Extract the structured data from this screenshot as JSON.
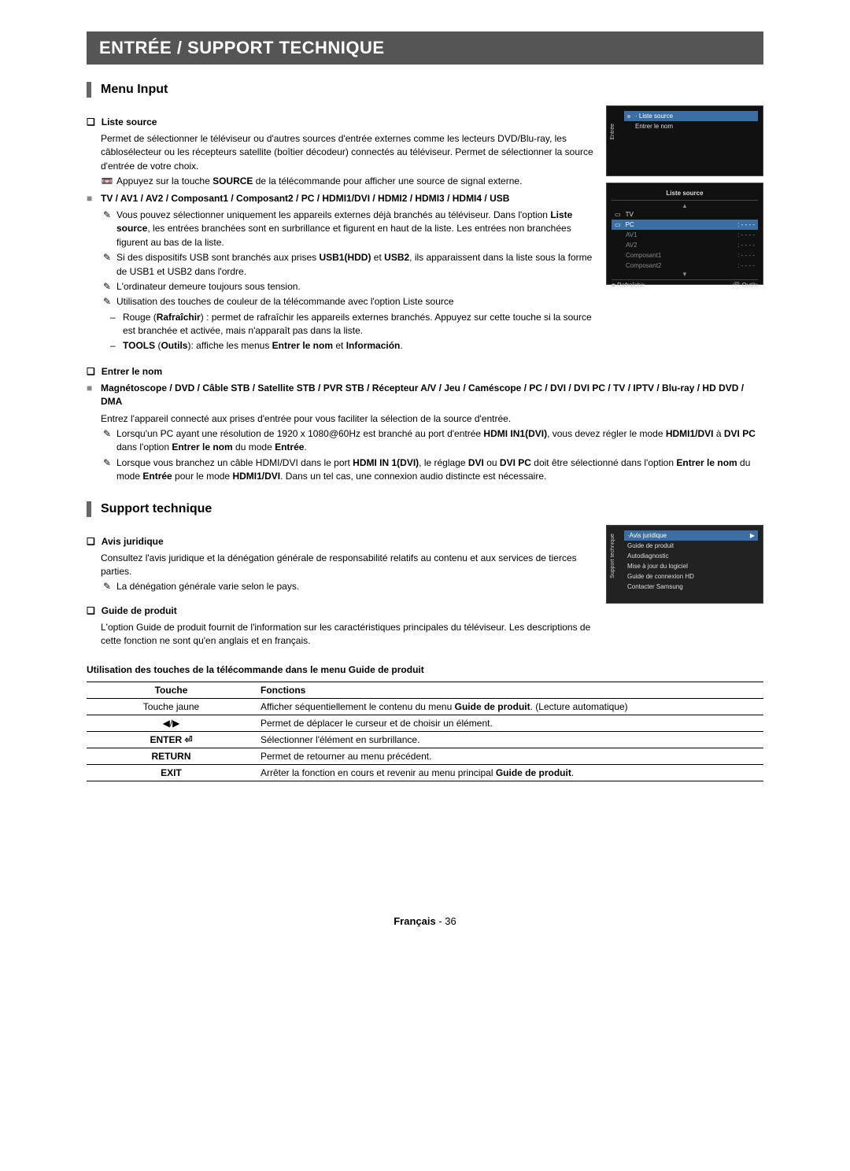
{
  "banner": "ENTRÉE / SUPPORT TECHNIQUE",
  "section1": {
    "title": "Menu Input",
    "liste_source": {
      "heading": "Liste source",
      "p1": "Permet de sélectionner le téléviseur ou d'autres sources d'entrée externes comme les lecteurs DVD/Blu-ray, les câblosélecteur ou les récepteurs satellite (boîtier décodeur) connectés au téléviseur. Permet de sélectionner la source d'entrée de votre choix.",
      "note_icon": "📼",
      "note1_pre": "Appuyez sur la touche ",
      "note1_b": "SOURCE",
      "note1_post": " de la télécommande pour afficher une source de signal externe.",
      "square": "■",
      "src_list_b": "TV / AV1 / AV2 / Composant1 / Composant2 / PC / HDMI1/DVI / HDMI2 / HDMI3 / HDMI4 / USB",
      "z_icon": "✎",
      "z1_pre": "Vous pouvez sélectionner uniquement les appareils externes déjà branchés au téléviseur. Dans l'option ",
      "z1_b": "Liste source",
      "z1_post": ", les entrées branchées sont en surbrillance et figurent en haut de la liste. Les entrées non branchées figurent au bas de la liste.",
      "z2_pre": "Si des dispositifs USB sont branchés aux prises ",
      "z2_b1": "USB1(HDD)",
      "z2_mid": " et ",
      "z2_b2": "USB2",
      "z2_post": ", ils apparaissent dans la liste sous la forme de USB1 et USB2 dans l'ordre.",
      "z3": "L'ordinateur demeure toujours sous tension.",
      "z4": "Utilisation des touches de couleur de la télécommande avec l'option Liste source",
      "dash1_pre": "Rouge (",
      "dash1_b": "Rafraîchir",
      "dash1_post": ") : permet de rafraîchir les appareils externes branchés. Appuyez sur cette touche si la source est branchée et activée, mais n'apparaît pas dans la liste.",
      "dash2_b1": "TOOLS",
      "dash2_mid1": " (",
      "dash2_b2": "Outils",
      "dash2_mid2": "): affiche les menus ",
      "dash2_b3": "Entrer le nom",
      "dash2_mid3": " et ",
      "dash2_b4": "Información",
      "dash2_end": "."
    },
    "entrer_nom": {
      "heading": "Entrer le nom",
      "square": "■",
      "devices_b": "Magnétoscope / DVD / Câble STB / Satellite STB / PVR STB / Récepteur A/V / Jeu / Caméscope / PC / DVI / DVI PC / TV / IPTV / Blu-ray / HD DVD / DMA",
      "p1": "Entrez l'appareil connecté aux prises d'entrée pour vous faciliter la sélection de la source d'entrée.",
      "z_icon": "✎",
      "z1_pre": "Lorsqu'un PC ayant une résolution de 1920 x 1080@60Hz est branché au port d'entrée ",
      "z1_b1": "HDMI IN1(DVI)",
      "z1_mid1": ", vous devez régler le mode ",
      "z1_b2": "HDMI1/DVI",
      "z1_mid2": " à ",
      "z1_b3": "DVI PC",
      "z1_mid3": " dans l'option ",
      "z1_b4": "Entrer le nom",
      "z1_mid4": " du mode ",
      "z1_b5": "Entrée",
      "z1_end": ".",
      "z2_pre": "Lorsque vous branchez un câble HDMI/DVI dans le port ",
      "z2_b1": "HDMI IN 1(DVI)",
      "z2_mid1": ", le réglage ",
      "z2_b2": "DVI",
      "z2_mid2": " ou ",
      "z2_b3": "DVI PC",
      "z2_mid3": " doit être sélectionné dans l'option ",
      "z2_b4": "Entrer le nom",
      "z2_mid4": " du mode ",
      "z2_b5": "Entrée",
      "z2_mid5": " pour le mode ",
      "z2_b6": "HDMI1/DVI",
      "z2_post": ". Dans un tel cas, une connexion audio distincte est nécessaire."
    }
  },
  "section2": {
    "title": "Support technique",
    "avis": {
      "heading": "Avis juridique",
      "p1": "Consultez l'avis juridique et la dénégation générale de responsabilité relatifs au contenu et aux services de tierces parties.",
      "z_icon": "✎",
      "z1": "La dénégation générale varie selon le pays."
    },
    "guide": {
      "heading": "Guide de produit",
      "p1": "L'option Guide de produit fournit de l'information sur les caractéristiques principales du téléviseur. Les descriptions de cette fonction ne sont qu'en anglais et en français."
    },
    "table_title": "Utilisation des touches de la télécommande dans le menu Guide de produit",
    "table": {
      "h1": "Touche",
      "h2": "Fonctions",
      "r1c1": "Touche jaune",
      "r1c2_pre": "Afficher séquentiellement le contenu du menu ",
      "r1c2_b": "Guide de produit",
      "r1c2_post": ". (Lecture automatique)",
      "r2c1": "◀/▶",
      "r2c2": "Permet de déplacer le curseur et de choisir un élément.",
      "r3c1": "ENTER ⏎",
      "r3c2": "Sélectionner l'élément en surbrillance.",
      "r4c1": "RETURN",
      "r4c2": "Permet de retourner au menu précédent.",
      "r5c1": "EXIT",
      "r5c2_pre": "Arrêter la fonction en cours et revenir au menu principal ",
      "r5c2_b": "Guide de produit",
      "r5c2_post": "."
    }
  },
  "screens": {
    "s1": {
      "side": "Entrée",
      "item1": "Liste source",
      "item2": "Entrer le nom"
    },
    "s2": {
      "title": "Liste source",
      "items": [
        "TV",
        "PC",
        "AV1",
        "AV2",
        "Composant1",
        "Composant2"
      ],
      "status": ": - - - -",
      "foot1": "■ Rafraîchir",
      "foot2": "🛠 Outils"
    },
    "s3": {
      "side": "Support technique",
      "item1": "Avis juridique",
      "items": [
        "Guide de produit",
        "Autodiagnostic",
        "Mise à jour du logiciel",
        "Guide de connexion HD",
        "Contacter Samsung"
      ]
    }
  },
  "footer": {
    "lang": "Français",
    "sep": " - ",
    "page": "36"
  }
}
